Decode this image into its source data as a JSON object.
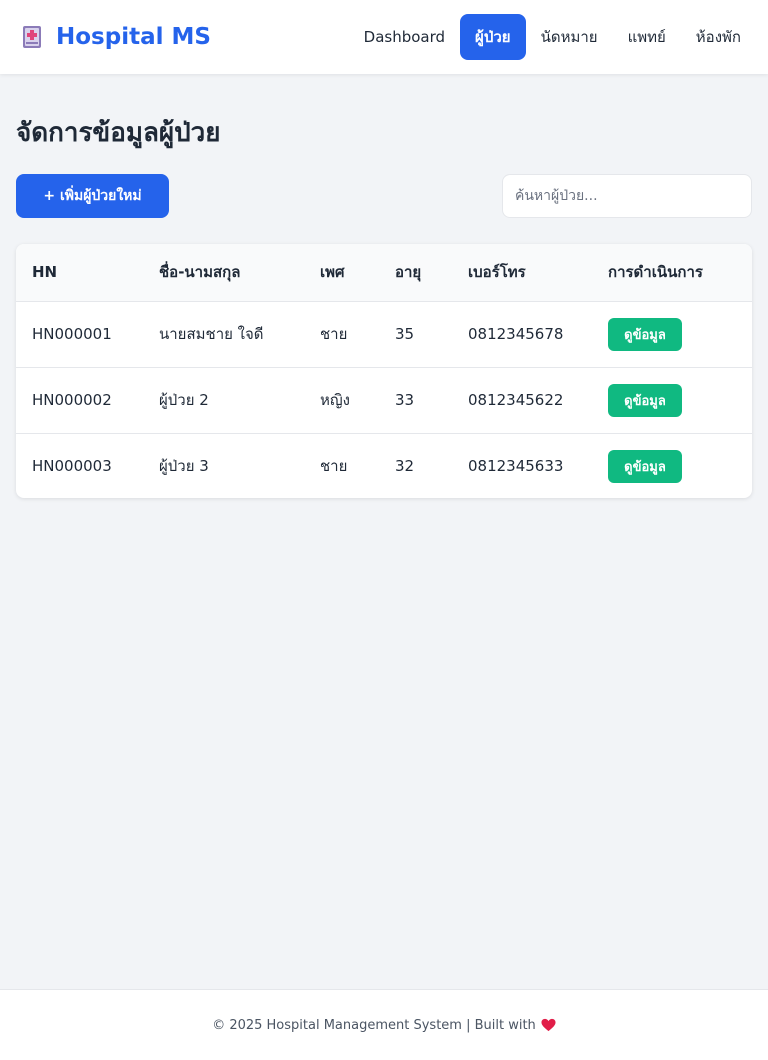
{
  "brand": {
    "title": "Hospital MS",
    "icon": "hospital-icon"
  },
  "nav": {
    "items": [
      {
        "label": "Dashboard",
        "active": false
      },
      {
        "label": "ผู้ป่วย",
        "active": true
      },
      {
        "label": "นัดหมาย",
        "active": false
      },
      {
        "label": "แพทย์",
        "active": false
      },
      {
        "label": "ห้องพัก",
        "active": false
      }
    ]
  },
  "page": {
    "title": "จัดการข้อมูลผู้ป่วย",
    "add_button_label": "+ เพิ่มผู้ป่วยใหม่",
    "search_placeholder": "ค้นหาผู้ป่วย..."
  },
  "table": {
    "columns": [
      "HN",
      "ชื่อ-นามสกุล",
      "เพศ",
      "อายุ",
      "เบอร์โทร",
      "การดำเนินการ"
    ],
    "rows": [
      {
        "hn": "HN000001",
        "name": "นายสมชาย ใจดี",
        "gender": "ชาย",
        "age": "35",
        "phone": "0812345678",
        "action": "ดูข้อมูล"
      },
      {
        "hn": "HN000002",
        "name": "ผู้ป่วย 2",
        "gender": "หญิง",
        "age": "33",
        "phone": "0812345622",
        "action": "ดูข้อมูล"
      },
      {
        "hn": "HN000003",
        "name": "ผู้ป่วย 3",
        "gender": "ชาย",
        "age": "32",
        "phone": "0812345633",
        "action": "ดูข้อมูล"
      }
    ]
  },
  "footer": {
    "text": "© 2025 Hospital Management System | Built with",
    "icon": "heart-icon"
  },
  "colors": {
    "primary": "#2563eb",
    "success": "#10b981",
    "background": "#f2f4f7",
    "heart": "#e11d48"
  }
}
